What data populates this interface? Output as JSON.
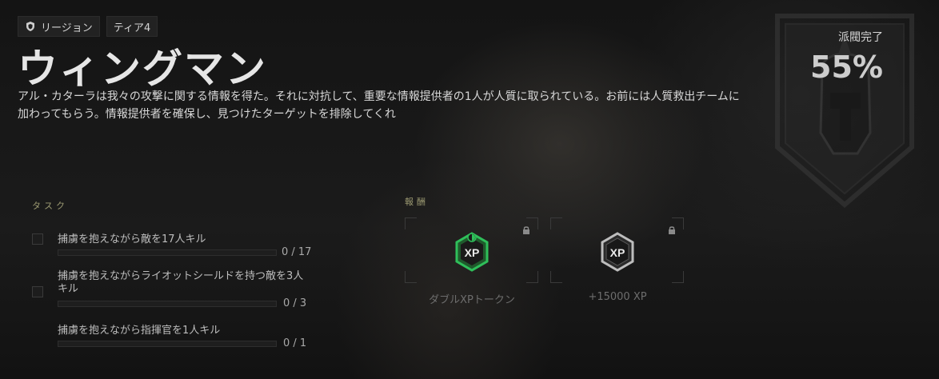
{
  "header": {
    "legion_label": "リージョン",
    "tier_label": "ティア4",
    "title": "ウィングマン",
    "description": "アル・カターラは我々の攻撃に関する情報を得た。それに対抗して、重要な情報提供者の1人が人質に取られている。お前には人質救出チームに加わってもらう。情報提供者を確保し、見つけたターゲットを排除してくれ"
  },
  "faction": {
    "complete_label": "派閥完了",
    "complete_value": "55%"
  },
  "tasks": {
    "section_label": "タスク",
    "items": [
      {
        "text": "捕虜を抱えながら敵を17人キル",
        "count": "0 / 17",
        "progress": 0
      },
      {
        "text": "捕虜を抱えながらライオットシールドを持つ敵を3人キル",
        "count": "0 / 3",
        "progress": 0
      },
      {
        "text": "捕虜を抱えながら指揮官を1人キル",
        "count": "0 / 1",
        "progress": 0
      }
    ]
  },
  "rewards": {
    "section_label": "報酬",
    "items": [
      {
        "label": "ダブルXPトークン",
        "icon": "double-xp-token-icon",
        "locked": true,
        "accent": "#2fbf5a"
      },
      {
        "label": "+15000 XP",
        "icon": "xp-icon",
        "locked": true,
        "accent": "#bdbdbd"
      }
    ]
  },
  "colors": {
    "background": "#151515",
    "section_label": "#9c9a72",
    "accent_green": "#2fbf5a"
  }
}
